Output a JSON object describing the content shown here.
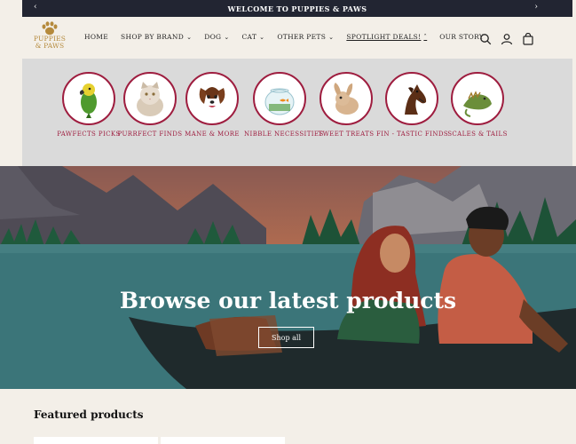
{
  "announcement": {
    "message": "WELCOME TO PUPPIES & PAWS",
    "prev_icon": "chevron-left-icon",
    "next_icon": "chevron-right-icon"
  },
  "logo": {
    "line1": "PUPPIES",
    "line2": "& PAWS"
  },
  "nav": [
    {
      "label": "HOME",
      "dropdown": false
    },
    {
      "label": "SHOP BY BRAND",
      "dropdown": true
    },
    {
      "label": "DOG",
      "dropdown": true
    },
    {
      "label": "CAT",
      "dropdown": true
    },
    {
      "label": "OTHER PETS",
      "dropdown": true
    },
    {
      "label": "SPOTLIGHT DEALS!",
      "dropdown": true,
      "active": true
    },
    {
      "label": "OUR STORY",
      "dropdown": false
    }
  ],
  "header_icons": [
    "search-icon",
    "account-icon",
    "cart-icon"
  ],
  "categories": [
    {
      "label": "PAWFECTS PICKS",
      "icon": "parrot"
    },
    {
      "label": "PURRFECT FINDS",
      "icon": "cat"
    },
    {
      "label": "MANE & MORE",
      "icon": "dog"
    },
    {
      "label": "NIBBLE NECESSITIES",
      "icon": "fishbowl"
    },
    {
      "label": "TWEET TREATS",
      "icon": "rabbit"
    },
    {
      "label": "FIN - TASTIC FINDS",
      "icon": "horse"
    },
    {
      "label": "SCALES & TAILS",
      "icon": "iguana"
    }
  ],
  "hero": {
    "title": "Browse our latest products",
    "button": "Shop all"
  },
  "featured": {
    "heading": "Featured products"
  },
  "colors": {
    "accent": "#9e1d3f",
    "dark": "#222532",
    "cream": "#f3efe8",
    "gold": "#b58a3c"
  }
}
